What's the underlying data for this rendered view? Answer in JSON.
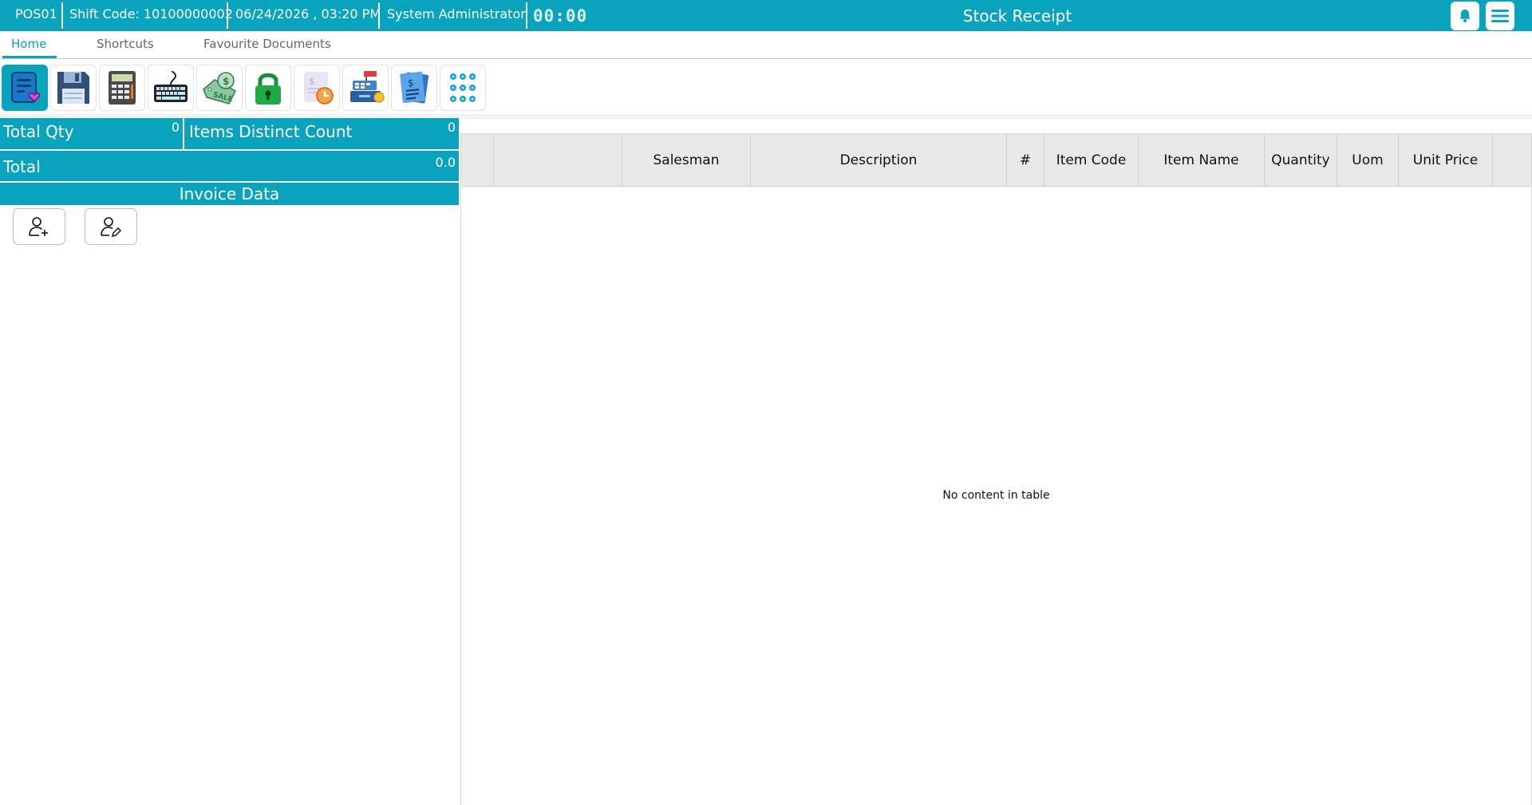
{
  "topbar": {
    "pos": "POS01",
    "shift": "Shift Code: 10100000002",
    "datetime": "06/24/2026 , 03:20 PM",
    "user": "System Administrator",
    "timer": "00:00",
    "title": "Stock Receipt",
    "bell_icon": "bell-icon",
    "menu_icon": "hamburger-menu-icon"
  },
  "tabs": [
    "Home",
    "Shortcuts",
    "Favourite Documents"
  ],
  "toolbar": [
    "document-favorite-icon",
    "save-icon",
    "calculator-icon",
    "keyboard-icon",
    "sale-tag-icon",
    "lock-icon",
    "scheduled-document-icon",
    "cash-register-icon",
    "invoice-papers-icon",
    "numpad-icon"
  ],
  "summary": {
    "total_qty_label": "Total Qty",
    "total_qty_value": "0",
    "distinct_label": "Items Distinct Count",
    "distinct_value": "0",
    "total_label": "Total",
    "total_value": "0.0",
    "invoice_data": "Invoice Data"
  },
  "customer_buttons": [
    "add-customer-icon",
    "edit-customer-icon"
  ],
  "grid": {
    "columns": [
      "",
      "",
      "Salesman",
      "Description",
      "#",
      "Item Code",
      "Item Name",
      "Quantity",
      "Uom",
      "Unit Price",
      ""
    ],
    "empty_text": "No content in table"
  },
  "colors": {
    "accent": "#0aa3be",
    "header_bg": "#e8e8e8"
  }
}
